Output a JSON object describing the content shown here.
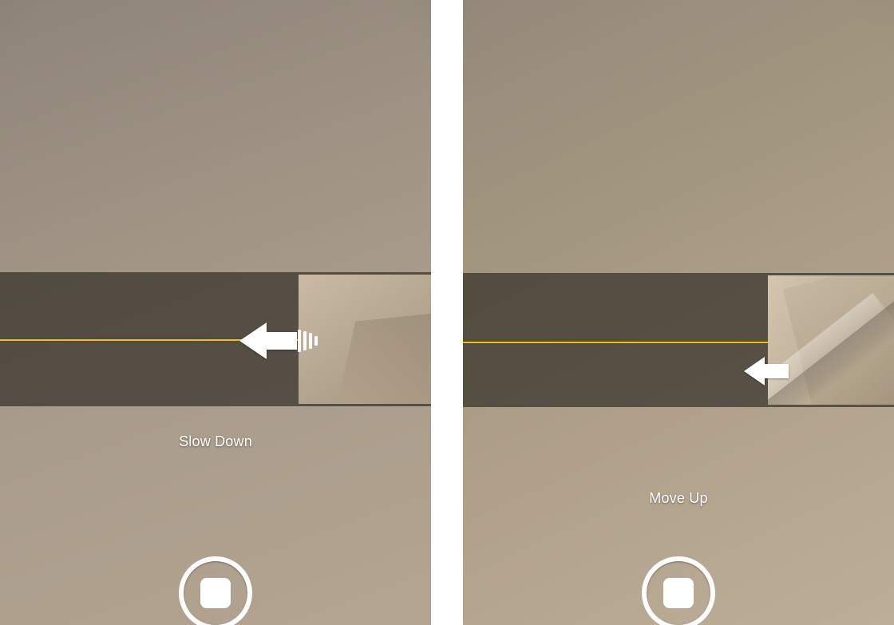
{
  "panels": {
    "left": {
      "instruction": "Slow Down",
      "arrow_icon": "arrow-left-icon",
      "has_trail": true
    },
    "right": {
      "instruction": "Move Up",
      "arrow_icon": "arrow-left-icon",
      "has_trail": false
    }
  },
  "controls": {
    "stop_label": "Stop"
  }
}
